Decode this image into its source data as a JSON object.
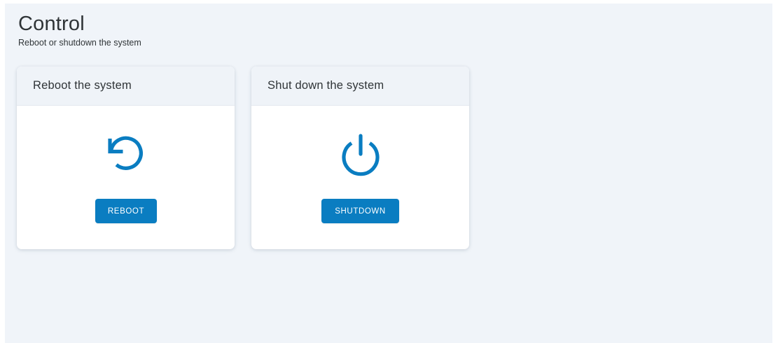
{
  "page": {
    "title": "Control",
    "subtitle": "Reboot or shutdown the system"
  },
  "cards": {
    "reboot": {
      "title": "Reboot the system",
      "icon": "restart-icon",
      "button_label": "REBOOT"
    },
    "shutdown": {
      "title": "Shut down the system",
      "icon": "power-icon",
      "button_label": "SHUTDOWN"
    }
  },
  "colors": {
    "accent": "#0a7dc1",
    "background": "#f0f4f9",
    "text": "#2f3437"
  }
}
